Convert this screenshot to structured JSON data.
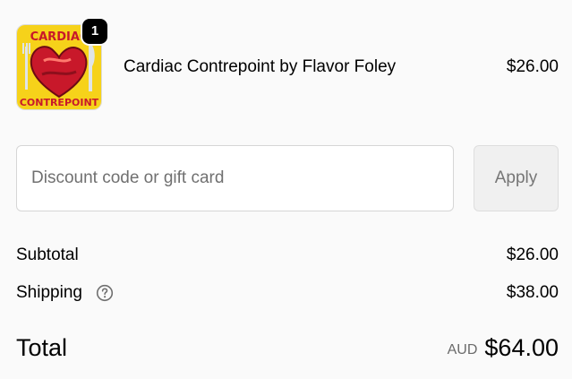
{
  "line_item": {
    "quantity": "1",
    "name": "Cardiac Contrepoint by Flavor Foley",
    "price": "$26.00",
    "thumbnail": {
      "text_top": "CARDIAC",
      "text_bottom": "CONTREPOINT"
    }
  },
  "discount": {
    "placeholder": "Discount code or gift card",
    "apply_label": "Apply"
  },
  "totals": {
    "subtotal_label": "Subtotal",
    "subtotal_value": "$26.00",
    "shipping_label": "Shipping",
    "shipping_value": "$38.00",
    "total_label": "Total",
    "currency": "AUD",
    "total_value": "$64.00"
  },
  "icons": {
    "shipping_help": "question-circle-icon"
  },
  "colors": {
    "page_background": "#fafafa",
    "badge_background": "#000000",
    "thumb_yellow": "#f6d21a",
    "thumb_red": "#c8182a"
  }
}
